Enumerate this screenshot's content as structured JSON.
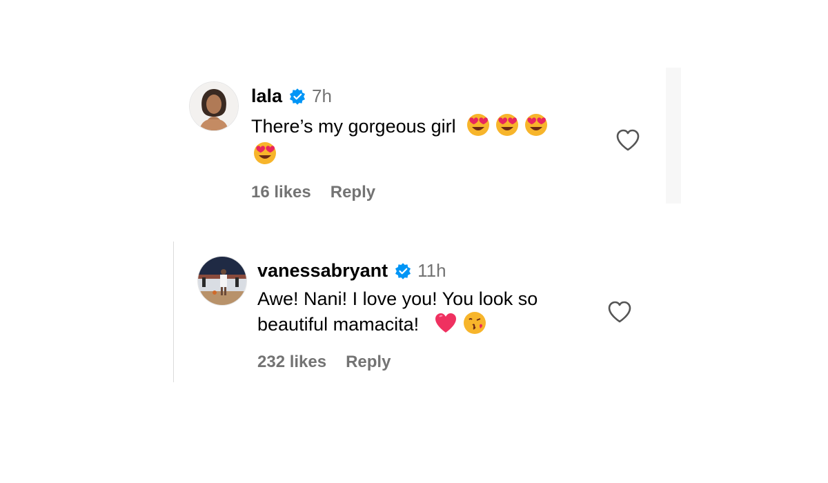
{
  "comments": [
    {
      "username": "lala",
      "time": "7h",
      "text": "There’s my gorgeous girl",
      "emojis": [
        "heart-eyes-emoji",
        "heart-eyes-emoji",
        "heart-eyes-emoji",
        "heart-eyes-emoji"
      ],
      "likes": "16 likes",
      "reply_label": "Reply"
    },
    {
      "username": "vanessabryant",
      "time": "11h",
      "text_line1": "Awe! Nani! I love you! You look so",
      "text_line2": "beautiful mamacita!",
      "emojis": [
        "red-heart-emoji",
        "kissing-face-emoji"
      ],
      "likes": "232 likes",
      "reply_label": "Reply"
    }
  ],
  "colors": {
    "verified": "#0095f6",
    "secondary_text": "#737373",
    "thread_line": "#dbdbdb"
  }
}
